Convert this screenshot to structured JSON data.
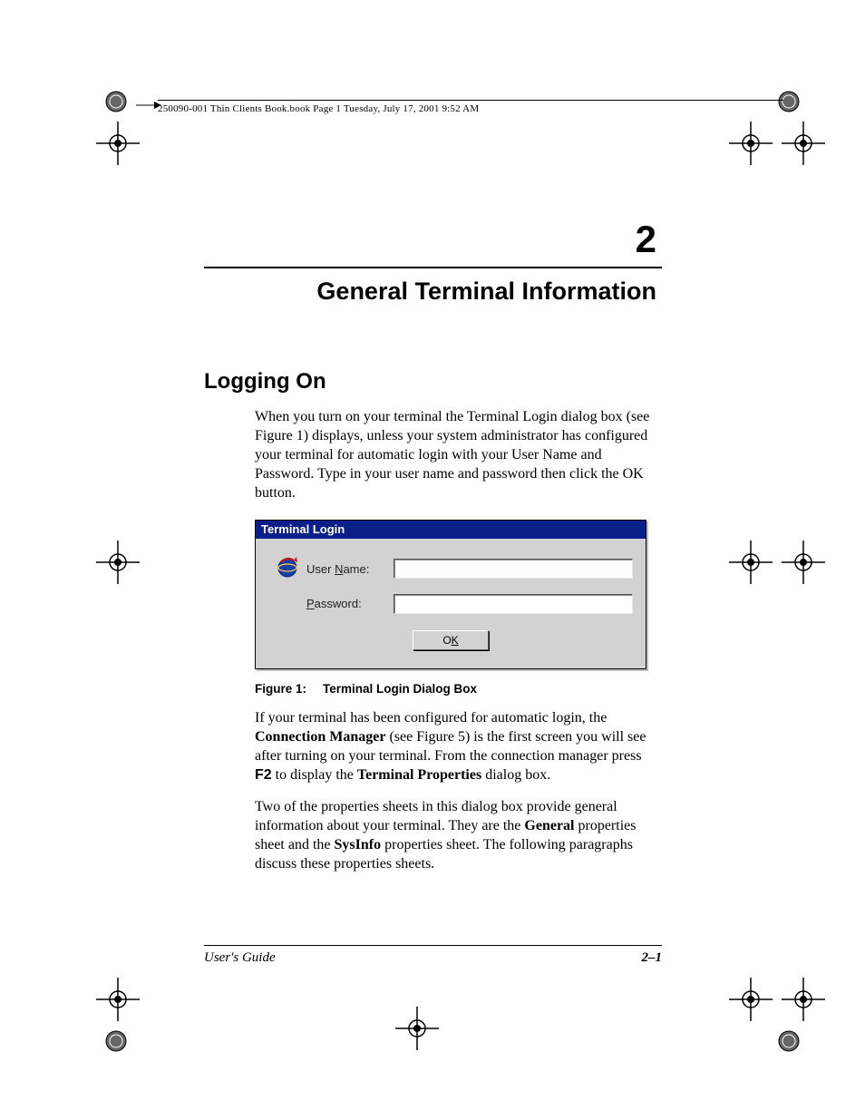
{
  "header_text": "250090-001 Thin Clients Book.book  Page 1  Tuesday, July 17, 2001  9:52 AM",
  "chapter": {
    "number": "2",
    "title": "General Terminal Information"
  },
  "section_heading": "Logging On",
  "para1": "When you turn on your terminal the Terminal Login dialog box (see Figure 1) displays, unless your system administrator has configured your terminal for automatic login with your User Name and Password. Type in your user name and password then click the OK button.",
  "dialog": {
    "title": "Terminal Login",
    "username_label_pre": "User ",
    "username_label_ul": "N",
    "username_label_post": "ame:",
    "password_label_ul": "P",
    "password_label_post": "assword:",
    "ok_pre": "O",
    "ok_ul": "K"
  },
  "figure_caption_label": "Figure 1:",
  "figure_caption_text": "Terminal Login Dialog Box",
  "para2_a": "If your terminal has been configured for automatic login, the ",
  "para2_bold1": "Connection Manager",
  "para2_b": " (see Figure 5) is the first screen you will see after turning on your terminal. From the connection manager press ",
  "para2_bold2": "F2",
  "para2_c": " to display the ",
  "para2_bold3": "Terminal Properties",
  "para2_d": " dialog box.",
  "para3_a": "Two of the properties sheets in this dialog box provide general information about your terminal. They are the ",
  "para3_bold1": "General",
  "para3_b": " properties sheet and the ",
  "para3_bold2": "SysInfo",
  "para3_c": " properties sheet. The following paragraphs discuss these properties sheets.",
  "footer_left": "User's Guide",
  "footer_right": "2–1"
}
